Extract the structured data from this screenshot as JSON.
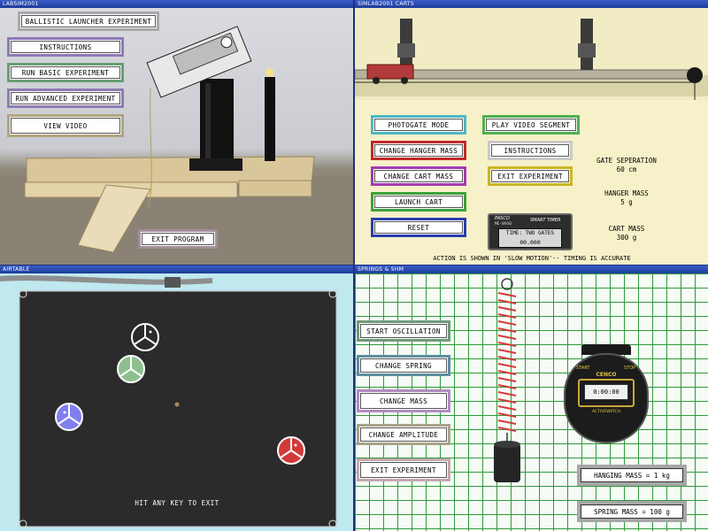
{
  "windows": {
    "ballistic": {
      "title": "LABSIM2001",
      "header_button": "BALLISTIC LAUNCHER EXPERIMENT",
      "buttons": [
        "INSTRUCTIONS",
        "RUN BASIC EXPERIMENT",
        "RUN ADVANCED EXPERIMENT",
        "VIEW VIDEO"
      ],
      "exit": "EXIT PROGRAM"
    },
    "cart": {
      "title": "SIMLAB2001  CARTS",
      "buttons_left": [
        "PHOTOGATE MODE",
        "CHANGE HANGER MASS",
        "CHANGE CART MASS",
        "LAUNCH CART",
        "RESET"
      ],
      "buttons_mid": [
        "PLAY VIDEO SEGMENT",
        "INSTRUCTIONS",
        "EXIT EXPERIMENT"
      ],
      "timer": {
        "brand": "PASCO",
        "model": "ME-8930",
        "name": "SMART TIMER",
        "mode": "TIME: TWO GATES",
        "value": "00.000"
      },
      "gate_separation": {
        "label": "GATE SEPERATION",
        "value": "60 cm"
      },
      "hanger_mass": {
        "label": "HANGER MASS",
        "value": "5 g"
      },
      "cart_mass": {
        "label": "CART MASS",
        "value": "300 g"
      },
      "footer": "ACTION IS SHOWN IN 'SLOW MOTION'-- TIMING IS ACCURATE"
    },
    "airtable": {
      "title": "AIRTABLE",
      "exit_hint": "HIT ANY KEY TO EXIT"
    },
    "springs": {
      "title": "SPRINGS & SHM",
      "buttons": [
        "START OSCILLATION",
        "CHANGE SPRING",
        "CHANGE MASS",
        "CHANGE AMPLITUDE",
        "EXIT EXPERIMENT"
      ],
      "stopwatch": {
        "start": "START",
        "stop": "STOP",
        "brand": "CENCO",
        "model": "ACTIVEWATCH",
        "display": "0:00:00"
      },
      "hanging_mass": "HANGING MASS = 1 kg",
      "spring_mass": "SPRING MASS = 100 g"
    }
  }
}
